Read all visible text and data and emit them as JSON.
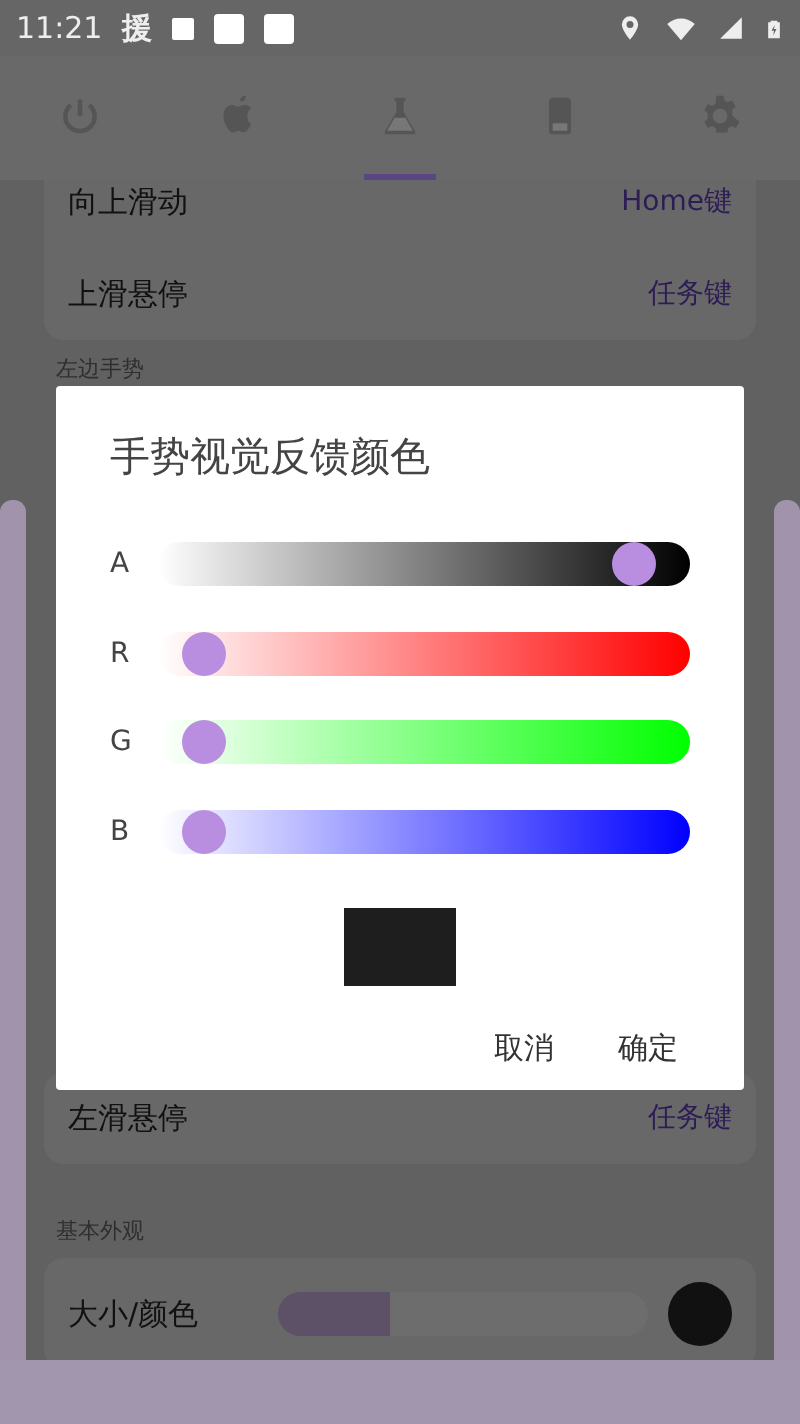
{
  "status_bar": {
    "time": "11:21",
    "app_char": "援"
  },
  "tabs": [
    {
      "kind": "power",
      "selected": false
    },
    {
      "kind": "apple",
      "selected": false
    },
    {
      "kind": "flask",
      "selected": true
    },
    {
      "kind": "phone",
      "selected": false
    },
    {
      "kind": "gear",
      "selected": false
    }
  ],
  "sections": [
    {
      "rows": [
        {
          "label": "向上滑动",
          "value": "Home键"
        },
        {
          "label": "上滑悬停",
          "value": "任务键"
        }
      ]
    },
    {
      "title": "左边手势",
      "rows": [
        {
          "label": "左滑悬停",
          "value": "任务键"
        }
      ]
    },
    {
      "title": "基本外观",
      "rows": [
        {
          "kind": "size_color",
          "label": "大小/颜色",
          "level": 0.3
        }
      ]
    }
  ],
  "dialog": {
    "title": "手势视觉反馈颜色",
    "channels": [
      {
        "label": "A",
        "level": 0.93
      },
      {
        "label": "R",
        "level": 0.05
      },
      {
        "label": "G",
        "level": 0.05
      },
      {
        "label": "B",
        "level": 0.05
      }
    ],
    "buttons": [
      "取消",
      "确定"
    ]
  }
}
